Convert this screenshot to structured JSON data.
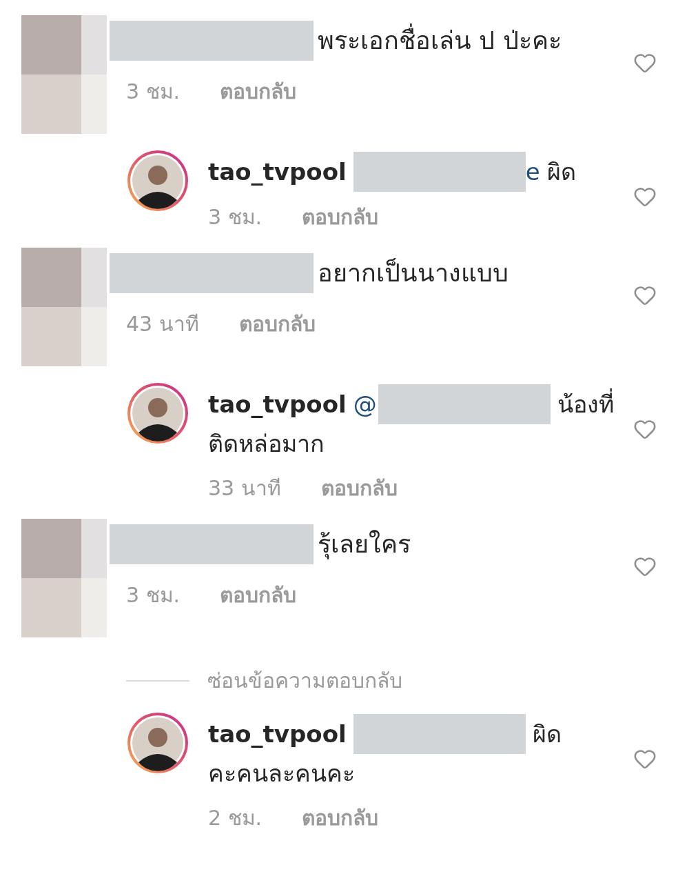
{
  "thread": [
    {
      "kind": "comment",
      "text": "พระเอกชื่อเล่น ป ป่ะคะ",
      "time": "3 ชม.",
      "reply_label": "ตอบกลับ"
    },
    {
      "kind": "reply",
      "username": "tao_tvpool",
      "mention": "e",
      "text": "ผิด",
      "time": "3 ชม.",
      "reply_label": "ตอบกลับ"
    },
    {
      "kind": "comment",
      "text": "อยากเป็นนางแบบ",
      "time": "43 นาที",
      "reply_label": "ตอบกลับ"
    },
    {
      "kind": "reply",
      "username": "tao_tvpool",
      "mention_prefix": "@",
      "text": "น้องที่",
      "text_continued": "ติดหล่อมาก",
      "time": "33 นาที",
      "reply_label": "ตอบกลับ"
    },
    {
      "kind": "comment",
      "text": "รุ้เลยใคร",
      "time": "3 ชม.",
      "reply_label": "ตอบกลับ"
    },
    {
      "kind": "hide_replies",
      "label": "ซ่อนข้อความตอบกลับ"
    },
    {
      "kind": "reply",
      "username": "tao_tvpool",
      "text": "ผิด",
      "text_continued": "คะคนละคนคะ",
      "time": "2 ชม.",
      "reply_label": "ตอบกลับ"
    }
  ]
}
